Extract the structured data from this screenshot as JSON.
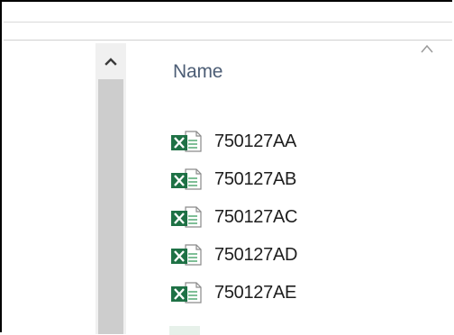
{
  "file_list": {
    "column_header": "Name",
    "items": [
      {
        "name": "750127AA",
        "icon": "excel-file-icon"
      },
      {
        "name": "750127AB",
        "icon": "excel-file-icon"
      },
      {
        "name": "750127AC",
        "icon": "excel-file-icon"
      },
      {
        "name": "750127AD",
        "icon": "excel-file-icon"
      },
      {
        "name": "750127AE",
        "icon": "excel-file-icon"
      }
    ]
  },
  "colors": {
    "header_text": "#4c5d75",
    "excel_green": "#1e7145",
    "scrollbar_thumb": "#cdcdcd",
    "scrollbar_track": "#f0f0f0"
  }
}
